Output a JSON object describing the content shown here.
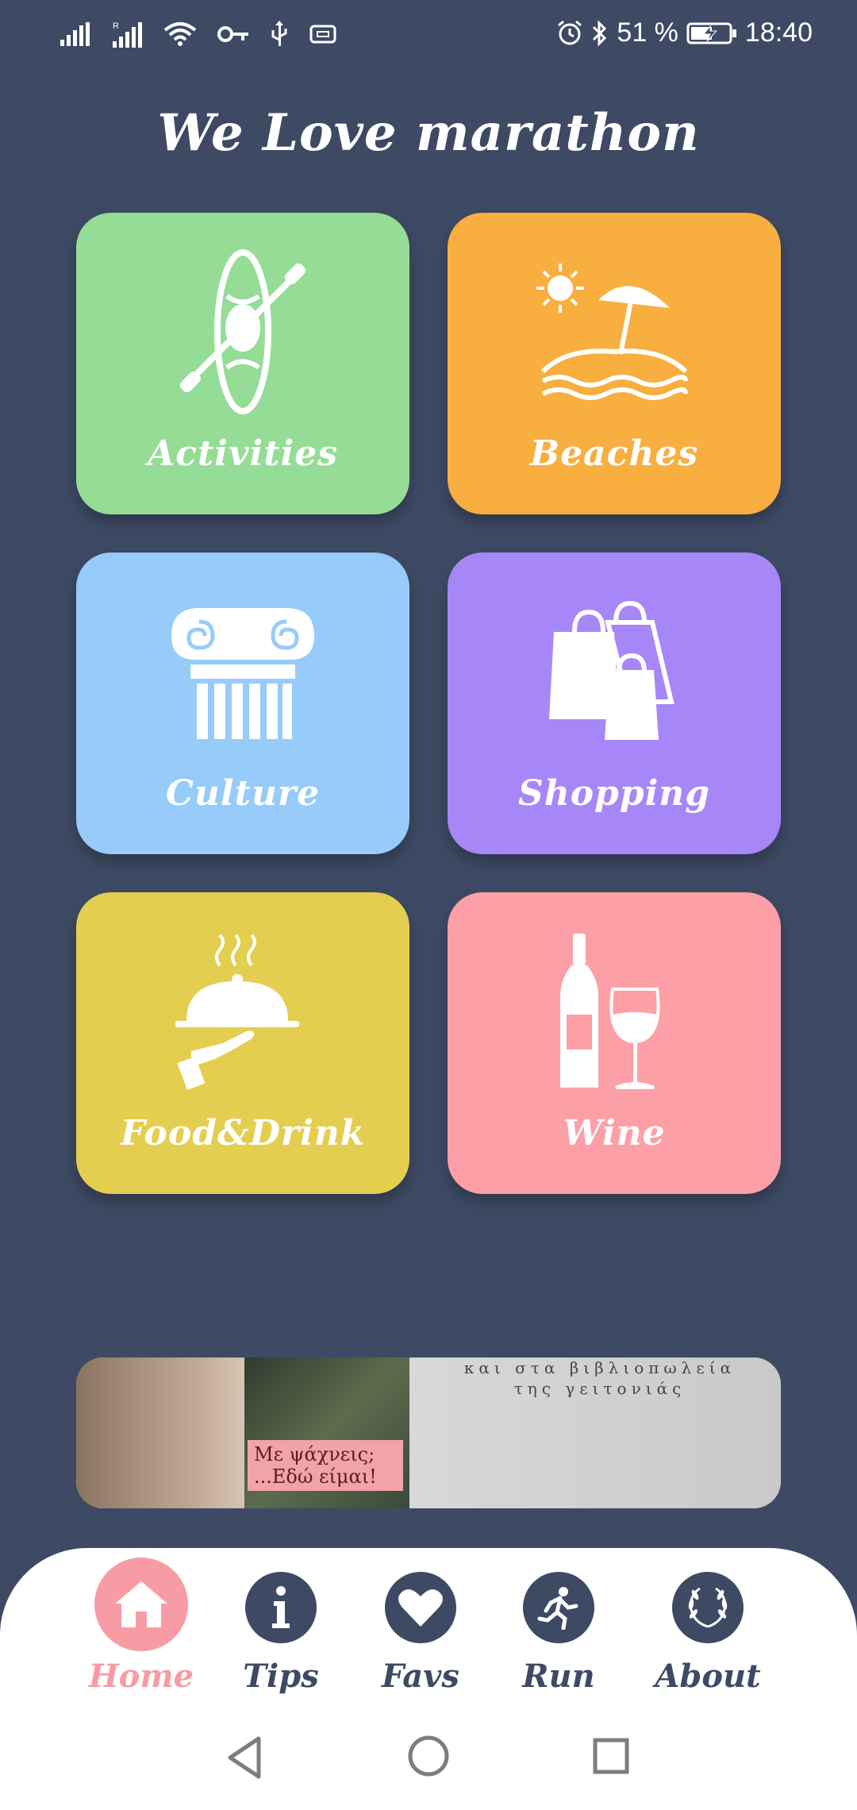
{
  "status_bar": {
    "battery": "51 %",
    "time": "18:40",
    "icons": [
      "signal-icon",
      "signal-roaming-icon",
      "wifi-icon",
      "vpn-key-icon",
      "usb-icon",
      "nfc-icon",
      "alarm-icon",
      "bluetooth-icon",
      "battery-charging-icon"
    ]
  },
  "header": {
    "title": "We Love marathon"
  },
  "tiles": [
    {
      "label": "Activities",
      "icon": "kayak-icon",
      "color": "#95dc96"
    },
    {
      "label": "Beaches",
      "icon": "beach-umbrella-icon",
      "color": "#f9ae40"
    },
    {
      "label": "Culture",
      "icon": "ionic-column-icon",
      "color": "#96cbfa"
    },
    {
      "label": "Shopping",
      "icon": "shopping-bags-icon",
      "color": "#a787f7"
    },
    {
      "label": "Food&Drink",
      "icon": "cloche-icon",
      "color": "#e4ce50"
    },
    {
      "label": "Wine",
      "icon": "wine-bottle-glass-icon",
      "color": "#fd9fa6"
    }
  ],
  "banner": {
    "text_line1": "και στα βιβλιοπωλεία",
    "text_line2": "της γειτονιάς",
    "book_tag_line1": "Με ψάχνεις;",
    "book_tag_line2": "...Εδώ είμαι!"
  },
  "bottom_nav": {
    "items": [
      {
        "label": "Home",
        "icon": "home-icon",
        "active": true
      },
      {
        "label": "Tips",
        "icon": "info-icon",
        "active": false
      },
      {
        "label": "Favs",
        "icon": "heart-icon",
        "active": false
      },
      {
        "label": "Run",
        "icon": "runner-icon",
        "active": false
      },
      {
        "label": "About",
        "icon": "laurel-wreath-icon",
        "active": false
      }
    ],
    "active_color": "#f79ca5",
    "inactive_color": "#3e4a64"
  },
  "system_nav": {
    "icons": [
      "back-icon",
      "home-circle-icon",
      "recents-icon"
    ]
  }
}
